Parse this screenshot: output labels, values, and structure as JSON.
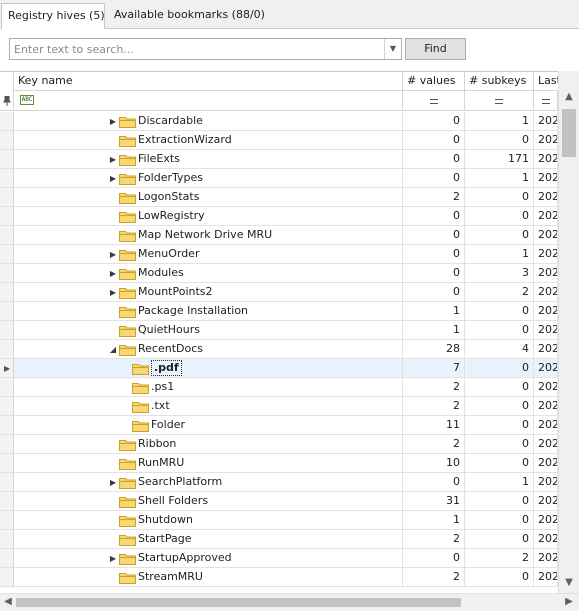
{
  "tabs": [
    {
      "label": "Registry hives (5)",
      "active": true
    },
    {
      "label": "Available bookmarks (88/0)",
      "active": false
    }
  ],
  "search": {
    "placeholder": "Enter text to search...",
    "value": "",
    "find_label": "Find"
  },
  "grid": {
    "columns": {
      "key_name": "Key name",
      "values": "# values",
      "subkeys": "# subkeys",
      "last_write": "Last wr"
    },
    "filter_row": {
      "key_name_icon": "text-filter-icon",
      "values_icon": "equals-filter-icon",
      "subkeys_icon": "equals-filter-icon",
      "last_write_icon": "equals-filter-icon"
    },
    "selected_row_indicator": "row-pointer-icon",
    "rows": [
      {
        "name": "Discardable",
        "values": "0",
        "subkeys": "1",
        "last": "202",
        "depth": 0,
        "expander": "collapsed"
      },
      {
        "name": "ExtractionWizard",
        "values": "0",
        "subkeys": "0",
        "last": "202",
        "depth": 0,
        "expander": "none"
      },
      {
        "name": "FileExts",
        "values": "0",
        "subkeys": "171",
        "last": "202",
        "depth": 0,
        "expander": "collapsed"
      },
      {
        "name": "FolderTypes",
        "values": "0",
        "subkeys": "1",
        "last": "202",
        "depth": 0,
        "expander": "collapsed"
      },
      {
        "name": "LogonStats",
        "values": "2",
        "subkeys": "0",
        "last": "202",
        "depth": 0,
        "expander": "none"
      },
      {
        "name": "LowRegistry",
        "values": "0",
        "subkeys": "0",
        "last": "202",
        "depth": 0,
        "expander": "none"
      },
      {
        "name": "Map Network Drive MRU",
        "values": "0",
        "subkeys": "0",
        "last": "202",
        "depth": 0,
        "expander": "none"
      },
      {
        "name": "MenuOrder",
        "values": "0",
        "subkeys": "1",
        "last": "202",
        "depth": 0,
        "expander": "collapsed"
      },
      {
        "name": "Modules",
        "values": "0",
        "subkeys": "3",
        "last": "202",
        "depth": 0,
        "expander": "collapsed"
      },
      {
        "name": "MountPoints2",
        "values": "0",
        "subkeys": "2",
        "last": "202",
        "depth": 0,
        "expander": "collapsed"
      },
      {
        "name": "Package Installation",
        "values": "1",
        "subkeys": "0",
        "last": "202",
        "depth": 0,
        "expander": "none"
      },
      {
        "name": "QuietHours",
        "values": "1",
        "subkeys": "0",
        "last": "202",
        "depth": 0,
        "expander": "none"
      },
      {
        "name": "RecentDocs",
        "values": "28",
        "subkeys": "4",
        "last": "202",
        "depth": 0,
        "expander": "expanded"
      },
      {
        "name": ".pdf",
        "values": "7",
        "subkeys": "0",
        "last": "202",
        "depth": 1,
        "expander": "none",
        "selected": true
      },
      {
        "name": ".ps1",
        "values": "2",
        "subkeys": "0",
        "last": "202",
        "depth": 1,
        "expander": "none"
      },
      {
        "name": ".txt",
        "values": "2",
        "subkeys": "0",
        "last": "202",
        "depth": 1,
        "expander": "none"
      },
      {
        "name": "Folder",
        "values": "11",
        "subkeys": "0",
        "last": "202",
        "depth": 1,
        "expander": "none"
      },
      {
        "name": "Ribbon",
        "values": "2",
        "subkeys": "0",
        "last": "202",
        "depth": 0,
        "expander": "none"
      },
      {
        "name": "RunMRU",
        "values": "10",
        "subkeys": "0",
        "last": "202",
        "depth": 0,
        "expander": "none"
      },
      {
        "name": "SearchPlatform",
        "values": "0",
        "subkeys": "1",
        "last": "202",
        "depth": 0,
        "expander": "collapsed"
      },
      {
        "name": "Shell Folders",
        "values": "31",
        "subkeys": "0",
        "last": "202",
        "depth": 0,
        "expander": "none"
      },
      {
        "name": "Shutdown",
        "values": "1",
        "subkeys": "0",
        "last": "202",
        "depth": 0,
        "expander": "none"
      },
      {
        "name": "StartPage",
        "values": "2",
        "subkeys": "0",
        "last": "202",
        "depth": 0,
        "expander": "none"
      },
      {
        "name": "StartupApproved",
        "values": "0",
        "subkeys": "2",
        "last": "202",
        "depth": 0,
        "expander": "collapsed"
      },
      {
        "name": "StreamMRU",
        "values": "2",
        "subkeys": "0",
        "last": "202",
        "depth": 0,
        "expander": "none"
      }
    ]
  },
  "colors": {
    "folder_fill": "#f8d775",
    "folder_stroke": "#c9a227",
    "selection": "#e8f3fd",
    "gridline": "#e2e2e2"
  },
  "scrollbars": {
    "vertical_icons": [
      "scroll-up-icon",
      "scroll-down-icon"
    ],
    "horizontal_icons": [
      "scroll-left-icon",
      "scroll-right-icon"
    ]
  }
}
